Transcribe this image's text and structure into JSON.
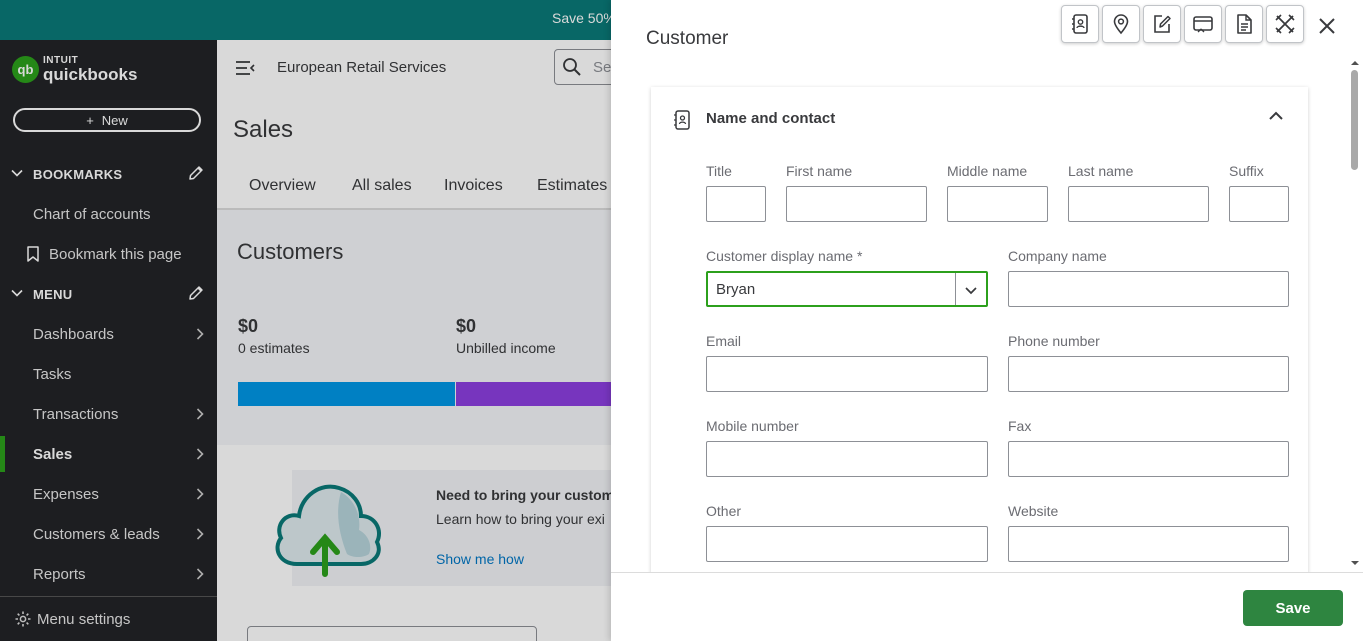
{
  "promo": {
    "text": "Save 50%"
  },
  "logo": {
    "mark": "qb",
    "intuit": "INTUIT",
    "product": "quickbooks"
  },
  "sidebar": {
    "new_label": "New",
    "bookmarks_label": "BOOKMARKS",
    "bookmarks": [
      {
        "label": "Chart of accounts"
      },
      {
        "label": "Bookmark this page"
      }
    ],
    "menu_label": "MENU",
    "items": [
      {
        "label": "Dashboards"
      },
      {
        "label": "Tasks"
      },
      {
        "label": "Transactions"
      },
      {
        "label": "Sales"
      },
      {
        "label": "Expenses"
      },
      {
        "label": "Customers & leads"
      },
      {
        "label": "Reports"
      }
    ],
    "active_item": "Sales",
    "menu_settings_label": "Menu settings",
    "colors": {
      "background": "#232427",
      "active_accent": "#2ca01c"
    }
  },
  "main": {
    "company_name": "European Retail Services",
    "search_placeholder": "Se",
    "page_title": "Sales",
    "tabs": [
      {
        "label": "Overview"
      },
      {
        "label": "All sales"
      },
      {
        "label": "Invoices"
      },
      {
        "label": "Estimates"
      }
    ],
    "customers_title": "Customers",
    "stats": [
      {
        "amount": "$0",
        "label": "0 estimates",
        "color": "#0097e6"
      },
      {
        "amount": "$0",
        "label": "Unbilled income",
        "color": "#8c3fe0"
      }
    ],
    "promo_card": {
      "title": "Need to bring your custome",
      "body": "Learn how to bring your exi",
      "link": "Show me how"
    }
  },
  "drawer": {
    "title": "Customer",
    "toolbar_icons": [
      "contact-card-icon",
      "location-pin-icon",
      "edit-note-icon",
      "payments-icon",
      "document-icon",
      "tools-icon"
    ],
    "section_title": "Name and contact",
    "fields": {
      "title": {
        "label": "Title",
        "value": ""
      },
      "first_name": {
        "label": "First name",
        "value": ""
      },
      "middle_name": {
        "label": "Middle name",
        "value": ""
      },
      "last_name": {
        "label": "Last name",
        "value": ""
      },
      "suffix": {
        "label": "Suffix",
        "value": ""
      },
      "display_name": {
        "label": "Customer display name *",
        "value": "Bryan"
      },
      "company_name": {
        "label": "Company name",
        "value": ""
      },
      "email": {
        "label": "Email",
        "value": ""
      },
      "phone": {
        "label": "Phone number",
        "value": ""
      },
      "mobile": {
        "label": "Mobile number",
        "value": ""
      },
      "fax": {
        "label": "Fax",
        "value": ""
      },
      "other": {
        "label": "Other",
        "value": ""
      },
      "website": {
        "label": "Website",
        "value": ""
      }
    },
    "save_label": "Save",
    "colors": {
      "save": "#2e8540",
      "focus_border": "#2ca01c"
    }
  }
}
